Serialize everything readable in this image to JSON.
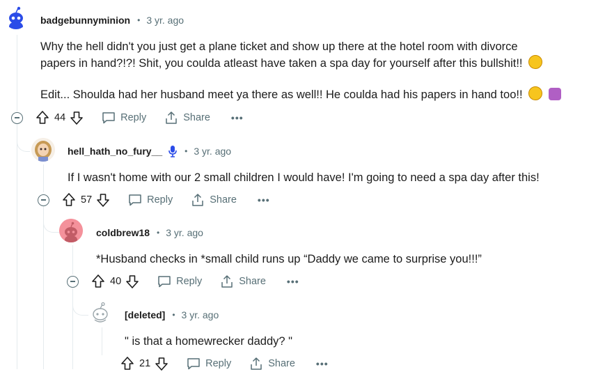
{
  "comments": [
    {
      "author": "badgebunnyminion",
      "time": "3 yr. ago",
      "lines": [
        "Why the hell didn't you just get a plane ticket and show up there at the hotel room with divorce",
        "papers in hand?!?! Shit, you coulda atleast have taken a spa day for yourself after this bullshit!!",
        "Edit... Shoulda had her husband meet ya there as well!! He coulda had his papers in hand too!!"
      ],
      "votes": "44"
    },
    {
      "author": "hell_hath_no_fury__",
      "time": "3 yr. ago",
      "lines": [
        "If I wasn't home with our 2 small children I would have! I'm going to need a spa day after this!"
      ],
      "votes": "57"
    },
    {
      "author": "coldbrew18",
      "time": "3 yr. ago",
      "lines": [
        "*Husband checks in *small child runs up “Daddy we came to surprise you!!!”"
      ],
      "votes": "40"
    },
    {
      "author": "[deleted]",
      "time": "3 yr. ago",
      "lines": [
        "\" is that a homewrecker daddy? \""
      ],
      "votes": "21"
    }
  ],
  "actions": {
    "reply": "Reply",
    "share": "Share",
    "more": "•••"
  },
  "separator": "•",
  "colors": {
    "meta": "#576f76",
    "thread": "#e5ebee",
    "avatar_blue": "#2b4ce8",
    "avatar_pink": "#f4919b"
  }
}
